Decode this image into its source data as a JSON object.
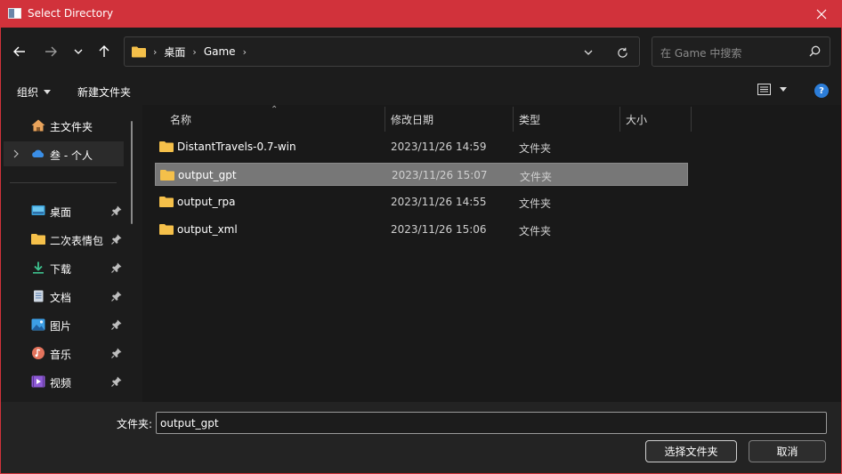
{
  "window": {
    "title": "Select Directory"
  },
  "nav": {
    "breadcrumbs": [
      "桌面",
      "Game"
    ],
    "search_placeholder": "在 Game 中搜索"
  },
  "toolbar": {
    "organize_label": "组织",
    "new_folder_label": "新建文件夹",
    "help_label": "?"
  },
  "sidebar": {
    "items": [
      {
        "label": "主文件夹",
        "icon": "home-icon",
        "pinned": false
      },
      {
        "label": "叁 - 个人",
        "icon": "onedrive-cloud-icon",
        "pinned": false,
        "selected": true
      },
      {
        "label": "桌面",
        "icon": "desktop-icon",
        "pinned": true
      },
      {
        "label": "二次表情包",
        "icon": "folder-icon",
        "pinned": true
      },
      {
        "label": "下载",
        "icon": "download-icon",
        "pinned": true
      },
      {
        "label": "文档",
        "icon": "document-icon",
        "pinned": true
      },
      {
        "label": "图片",
        "icon": "pictures-icon",
        "pinned": true
      },
      {
        "label": "音乐",
        "icon": "music-icon",
        "pinned": true
      },
      {
        "label": "视频",
        "icon": "video-icon",
        "pinned": true
      }
    ]
  },
  "files": {
    "columns": [
      "名称",
      "修改日期",
      "类型",
      "大小"
    ],
    "rows": [
      {
        "name": "DistantTravels-0.7-win",
        "date": "2023/11/26 14:59",
        "type": "文件夹"
      },
      {
        "name": "output_gpt",
        "date": "2023/11/26 15:07",
        "type": "文件夹",
        "selected": true
      },
      {
        "name": "output_rpa",
        "date": "2023/11/26 14:55",
        "type": "文件夹"
      },
      {
        "name": "output_xml",
        "date": "2023/11/26 15:06",
        "type": "文件夹"
      }
    ]
  },
  "footer": {
    "folder_label": "文件夹:",
    "folder_value": "output_gpt",
    "select_button": "选择文件夹",
    "cancel_button": "取消"
  },
  "colors": {
    "titlebar": "#d1323b",
    "folder": "#f5c04a",
    "selection": "#777777",
    "help": "#2c7dd8"
  }
}
